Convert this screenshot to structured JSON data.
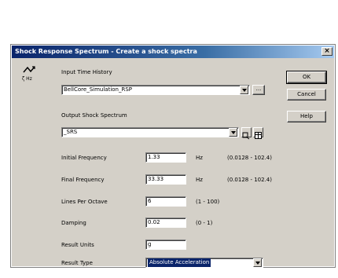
{
  "window": {
    "title": "Shock Response Spectrum - Create a shock spectra",
    "close_glyph": "×"
  },
  "icon": {
    "name": "shock-spectrum-icon",
    "caption": "ζ Hz"
  },
  "input": {
    "label": "Input Time History",
    "value": "BellCore_Simulation_RSP",
    "browse_label": "..."
  },
  "output": {
    "label": "Output Shock Spectrum",
    "value": "_SRS"
  },
  "params": {
    "initial_frequency": {
      "label": "Initial Frequency",
      "value": "1.33",
      "unit": "Hz",
      "range": "(0.0128 - 102.4)"
    },
    "final_frequency": {
      "label": "Final Frequency",
      "value": "33.33",
      "unit": "Hz",
      "range": "(0.0128 - 102.4)"
    },
    "lines_per_octave": {
      "label": "Lines Per Octave",
      "value": "6",
      "range": "(1 - 100)"
    },
    "damping": {
      "label": "Damping",
      "value": "0.02",
      "range": "(0 - 1)"
    },
    "result_units": {
      "label": "Result Units",
      "value": "g"
    },
    "result_type": {
      "label": "Result Type",
      "value": "Absolute Acceleration"
    }
  },
  "buttons": {
    "ok": "OK",
    "cancel": "Cancel",
    "help": "Help"
  }
}
